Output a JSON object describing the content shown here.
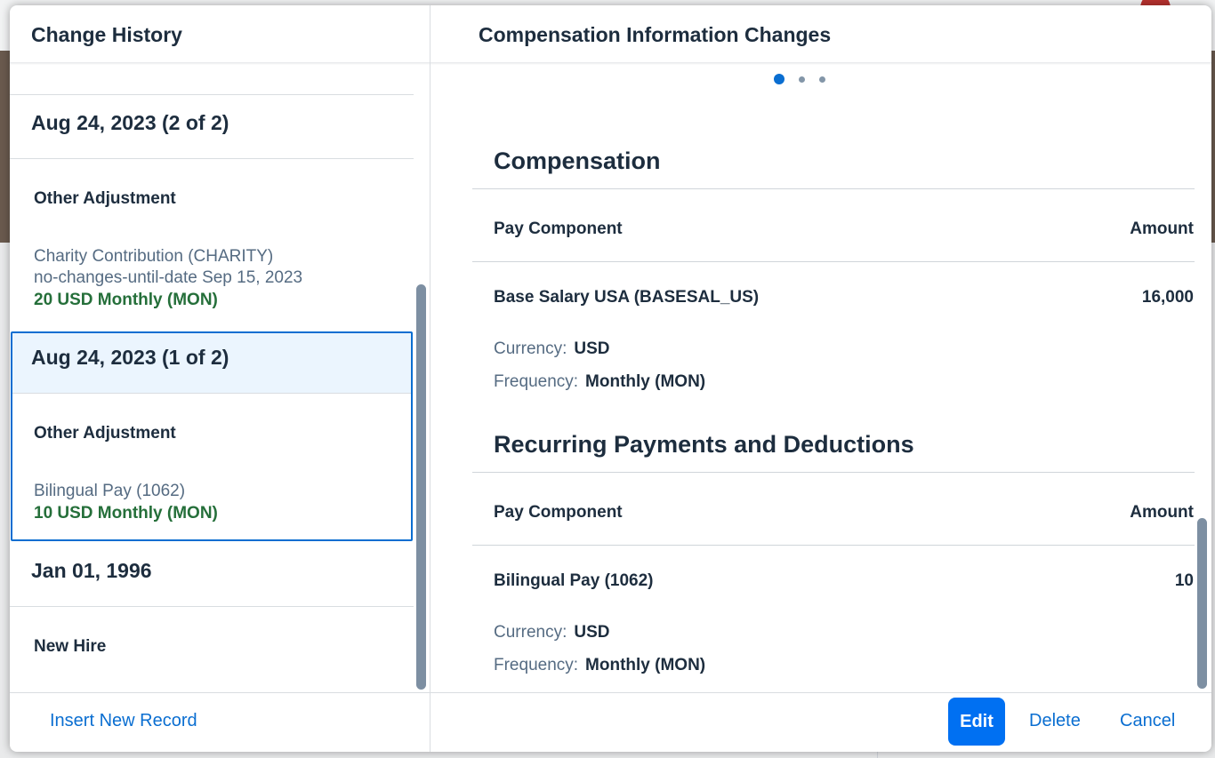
{
  "dialog": {
    "left_title": "Change History",
    "right_title": "Compensation Information Changes"
  },
  "history": [
    {
      "date": "Aug 24, 2023 (2 of 2)",
      "event": "Other Adjustment",
      "detail_lines": [
        "Charity Contribution (CHARITY)",
        "no-changes-until-date Sep 15, 2023"
      ],
      "amount": "20 USD Monthly (MON)",
      "selected": false
    },
    {
      "date": "Aug 24, 2023 (1 of 2)",
      "event": "Other Adjustment",
      "detail_lines": [
        "Bilingual Pay (1062)"
      ],
      "amount": "10 USD Monthly (MON)",
      "selected": true
    },
    {
      "date": "Jan 01, 1996",
      "event": "New Hire"
    }
  ],
  "carousel": {
    "pages": 3,
    "active": 0
  },
  "compensation": {
    "title": "Compensation",
    "col_component": "Pay Component",
    "col_amount": "Amount",
    "item": {
      "name": "Base Salary USA (BASESAL_US)",
      "amount": "16,000",
      "currency_label": "Currency:",
      "currency": "USD",
      "frequency_label": "Frequency:",
      "frequency": "Monthly (MON)"
    }
  },
  "recurring": {
    "title": "Recurring Payments and Deductions",
    "col_component": "Pay Component",
    "col_amount": "Amount",
    "item": {
      "name": "Bilingual Pay (1062)",
      "amount": "10",
      "currency_label": "Currency:",
      "currency": "USD",
      "frequency_label": "Frequency:",
      "frequency": "Monthly (MON)"
    }
  },
  "footer": {
    "insert_label": "Insert New Record",
    "edit_label": "Edit",
    "delete_label": "Delete",
    "cancel_label": "Cancel"
  },
  "colors": {
    "accent": "#0a6ed1",
    "button": "#0070f2",
    "positive": "#256f3a",
    "selected_bg": "#ebf5fe"
  }
}
